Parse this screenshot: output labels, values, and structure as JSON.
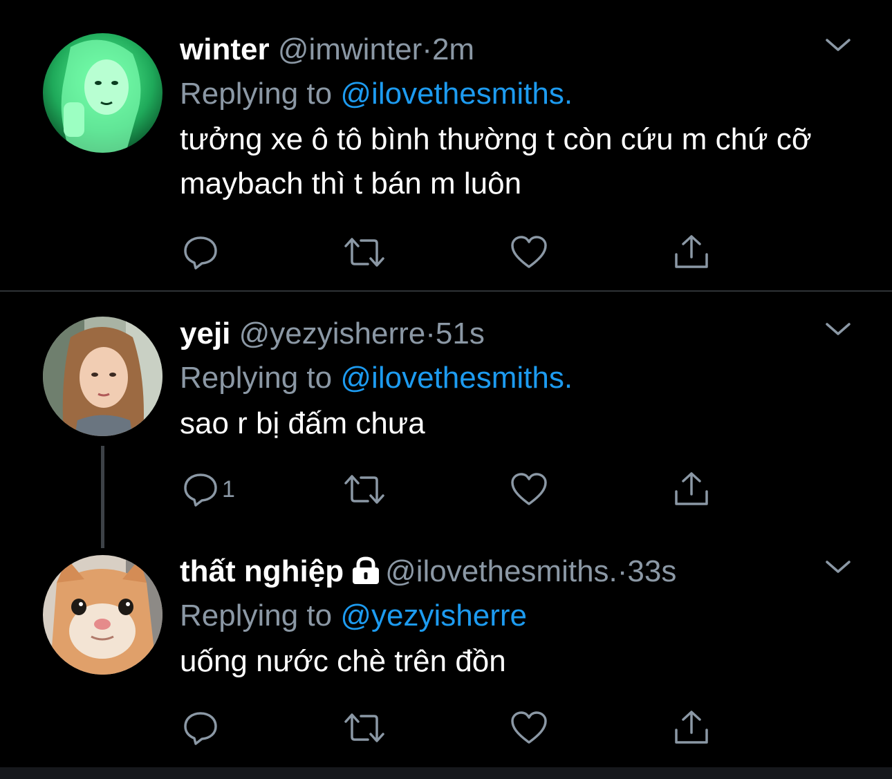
{
  "tweets": [
    {
      "name": "winter",
      "handle": "@imwinter",
      "dot": "·",
      "time": "2m",
      "replying_prefix": "Replying to",
      "replying_to": "@ilovethesmiths.",
      "text": "tưởng xe ô tô bình thường t còn cứu m chứ cỡ maybach thì t bán m luôn",
      "reply_count": "",
      "avatar_icon": "green-toned-portrait-avatar"
    },
    {
      "name": "yeji",
      "handle": "@yezyisherre",
      "dot": "·",
      "time": "51s",
      "replying_prefix": "Replying to",
      "replying_to": "@ilovethesmiths.",
      "text": "sao r bị đấm chưa",
      "reply_count": "1",
      "avatar_icon": "selfie-portrait-avatar"
    },
    {
      "name": "thất nghiệp",
      "handle": "@ilovethesmiths.",
      "dot": "·",
      "time": "33s",
      "replying_prefix": "Replying to",
      "replying_to": "@yezyisherre",
      "text": "uống nước chè trên đồn",
      "reply_count": "",
      "protected": true,
      "avatar_icon": "orange-cat-avatar"
    }
  ],
  "colors": {
    "background": "#000000",
    "primary_text": "#ffffff",
    "secondary_text": "#8b98a5",
    "mention": "#1d9bf0",
    "divider": "#2f3336"
  }
}
